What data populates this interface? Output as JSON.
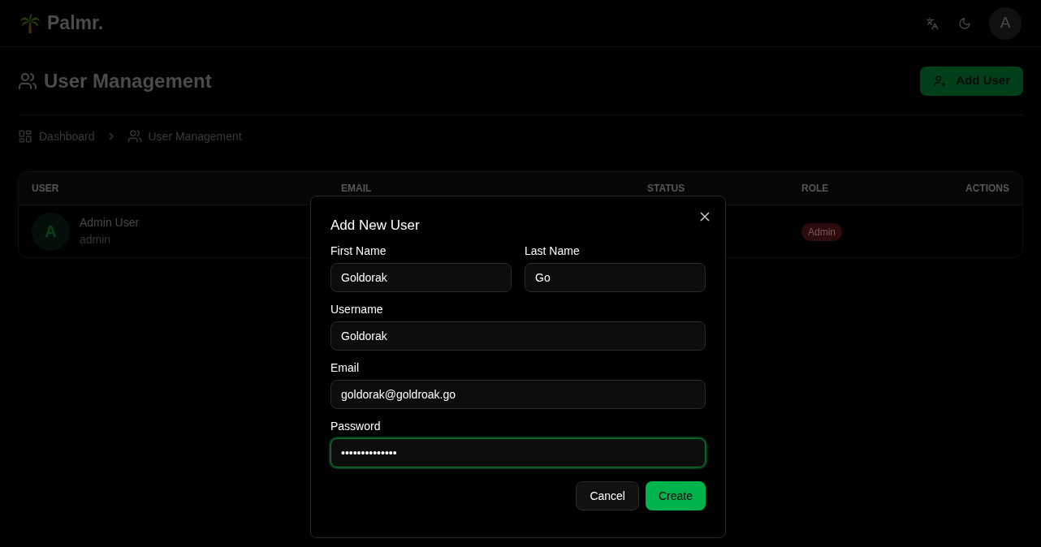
{
  "header": {
    "logo_text": "Palmr.",
    "avatar_initial": "A"
  },
  "page": {
    "title": "User Management",
    "add_button": "Add User"
  },
  "breadcrumb": [
    {
      "label": "Dashboard"
    },
    {
      "label": "User Management"
    }
  ],
  "table": {
    "columns": [
      "USER",
      "EMAIL",
      "STATUS",
      "ROLE",
      "ACTIONS"
    ],
    "rows": [
      {
        "avatar_initial": "A",
        "name": "Admin User",
        "username": "admin",
        "role": "Admin"
      }
    ]
  },
  "dialog": {
    "title": "Add New User",
    "field_rows": [
      [
        {
          "label": "First Name",
          "value": "Goldorak",
          "focused": false
        },
        {
          "label": "Last Name",
          "value": "Go",
          "focused": false
        }
      ],
      [
        {
          "label": "Username",
          "value": "Goldorak",
          "focused": false
        }
      ],
      [
        {
          "label": "Email",
          "value": "goldorak@goldroak.go",
          "focused": false
        }
      ],
      [
        {
          "label": "Password",
          "value": "••••••••••••••",
          "focused": true
        }
      ]
    ],
    "buttons": [
      {
        "label": "Cancel",
        "kind": "secondary"
      },
      {
        "label": "Create",
        "kind": "primary"
      }
    ]
  }
}
